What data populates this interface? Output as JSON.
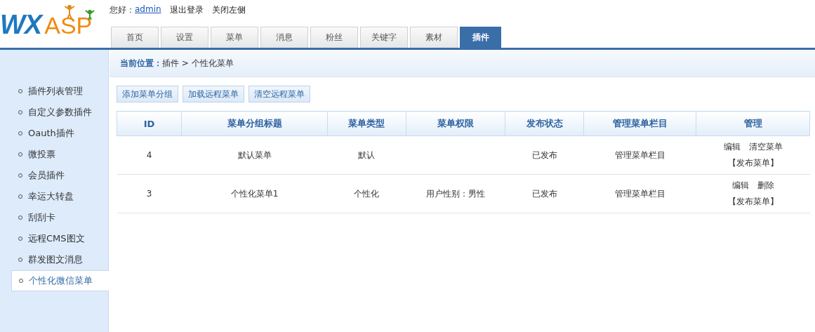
{
  "logo": {
    "part_1": "WX",
    "part_2": "ASP"
  },
  "top_links": {
    "greeting": "您好：",
    "user": "admin",
    "logout": "退出登录",
    "close_left": "关闭左侧"
  },
  "tabs": [
    {
      "label": "首页",
      "selected": false
    },
    {
      "label": "设置",
      "selected": false
    },
    {
      "label": "菜单",
      "selected": false
    },
    {
      "label": "消息",
      "selected": false
    },
    {
      "label": "粉丝",
      "selected": false
    },
    {
      "label": "关键字",
      "selected": false
    },
    {
      "label": "素材",
      "selected": false
    },
    {
      "label": "插件",
      "selected": true
    }
  ],
  "sidebar": {
    "items": [
      {
        "label": "插件列表管理",
        "selected": false
      },
      {
        "label": "自定义参数插件",
        "selected": false
      },
      {
        "label": "Oauth插件",
        "selected": false
      },
      {
        "label": "微投票",
        "selected": false
      },
      {
        "label": "会员插件",
        "selected": false
      },
      {
        "label": "幸运大转盘",
        "selected": false
      },
      {
        "label": "刮刮卡",
        "selected": false
      },
      {
        "label": "远程CMS图文",
        "selected": false
      },
      {
        "label": "群发图文消息",
        "selected": false
      },
      {
        "label": "个性化微信菜单",
        "selected": true
      }
    ]
  },
  "breadcrumb": {
    "label": "当前位置：",
    "path": "插件 > 个性化菜单"
  },
  "buttons": [
    "添加菜单分组",
    "加载远程菜单",
    "清空远程菜单"
  ],
  "table": {
    "columns": [
      "ID",
      "菜单分组标题",
      "菜单类型",
      "菜单权限",
      "发布状态",
      "管理菜单栏目",
      "管理"
    ],
    "rows": [
      {
        "id": "4",
        "title": "默认菜单",
        "type": "默认",
        "permission": "",
        "status": "已发布",
        "manage_items": "管理菜单栏目",
        "actions": [
          "编辑",
          "清空菜单"
        ],
        "publish": "【发布菜单】"
      },
      {
        "id": "3",
        "title": "个性化菜单1",
        "type": "个性化",
        "permission": "用户性别：男性",
        "status": "已发布",
        "manage_items": "管理菜单栏目",
        "actions": [
          "编辑",
          "删除"
        ],
        "publish": "【发布菜单】"
      }
    ]
  }
}
